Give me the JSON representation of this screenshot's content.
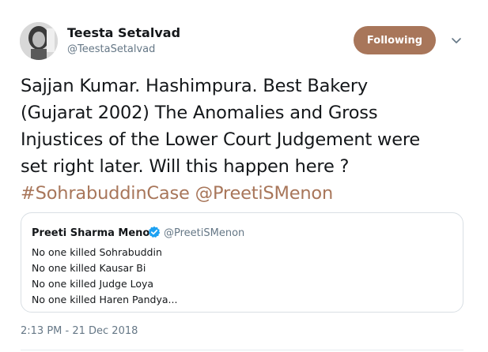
{
  "author": {
    "name": "Teesta Setalvad",
    "handle": "@TeestaSetalvad",
    "follow_label": "Following",
    "accent_color": "#a8765a"
  },
  "tweet": {
    "lines": [
      "Sajjan Kumar. Hashimpura. Best Bakery",
      "(Gujarat 2002) The Anomalies and Gross",
      "Injustices of the Lower Court Judgement were",
      "set right later. Will this happen here ?"
    ],
    "hashtag": "#SohrabuddinCase",
    "mention": "@PreetiSMenon",
    "timestamp": "2:13 PM - 21 Dec 2018"
  },
  "quoted": {
    "name": "Preeti Sharma Menon",
    "handle": "@PreetiSMenon",
    "verified_icon": "verified-badge-icon",
    "lines": [
      "No one killed Sohrabuddin",
      "No one killed Kausar Bi",
      "No one killed Judge Loya",
      "No one killed Haren Pandya..."
    ]
  },
  "icons": {
    "caret": "chevron-down-icon",
    "avatar": "profile-photo"
  }
}
